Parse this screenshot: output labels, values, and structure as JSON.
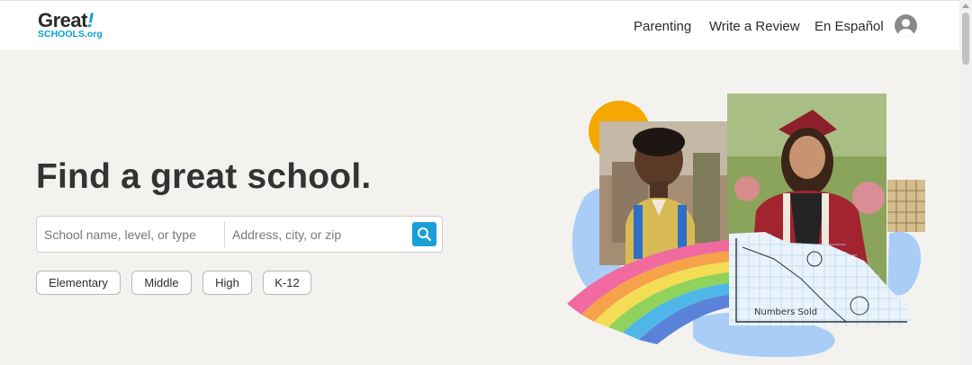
{
  "header": {
    "logo": {
      "top": "Great",
      "bang": "!",
      "bottom": "SCHOOLS.org"
    },
    "nav": {
      "parenting": "Parenting",
      "review": "Write a Review",
      "espanol": "En Español"
    }
  },
  "hero": {
    "title": "Find a great school.",
    "search": {
      "name_placeholder": "School name, level, or type",
      "address_placeholder": "Address, city, or zip"
    },
    "chips": {
      "elementary": "Elementary",
      "middle": "Middle",
      "high": "High",
      "k12": "K-12"
    },
    "illustration": {
      "chart_text": "Numbers Sold"
    }
  },
  "colors": {
    "brand_blue": "#0a9ed9",
    "search_button": "#1a9fd6",
    "hero_background": "#f3f2ef",
    "accent_orange": "#f5a800",
    "accent_light_blue": "#a9cdf7"
  },
  "icons": {
    "search": "search-icon",
    "user": "user-avatar-icon"
  }
}
